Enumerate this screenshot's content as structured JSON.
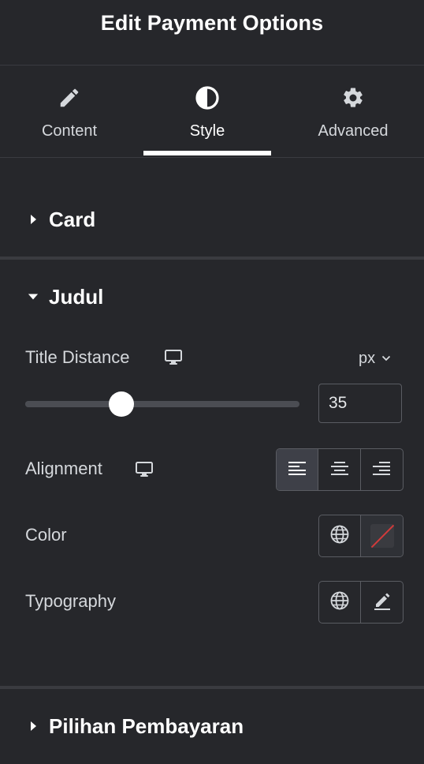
{
  "panel": {
    "title": "Edit Payment Options"
  },
  "tabs": [
    {
      "label": "Content",
      "icon": "pencil-icon",
      "active": false
    },
    {
      "label": "Style",
      "icon": "half-circle-icon",
      "active": true
    },
    {
      "label": "Advanced",
      "icon": "gear-icon",
      "active": false
    }
  ],
  "sections": {
    "card": {
      "title": "Card",
      "expanded": false
    },
    "judul": {
      "title": "Judul",
      "expanded": true
    },
    "pilihan": {
      "title": "Pilihan Pembayaran",
      "expanded": false
    }
  },
  "controls": {
    "title_distance": {
      "label": "Title Distance",
      "unit": "px",
      "value": "35",
      "slider_fraction": 0.35
    },
    "alignment": {
      "label": "Alignment",
      "options": [
        "left",
        "center",
        "right"
      ],
      "selected": "left"
    },
    "color": {
      "label": "Color"
    },
    "typography": {
      "label": "Typography"
    }
  },
  "colors": {
    "background": "#26272b",
    "divider": "#3a3b40",
    "text": "#d5d8dc",
    "heading": "#ffffff",
    "swatch_slash": "#d23a3a"
  }
}
